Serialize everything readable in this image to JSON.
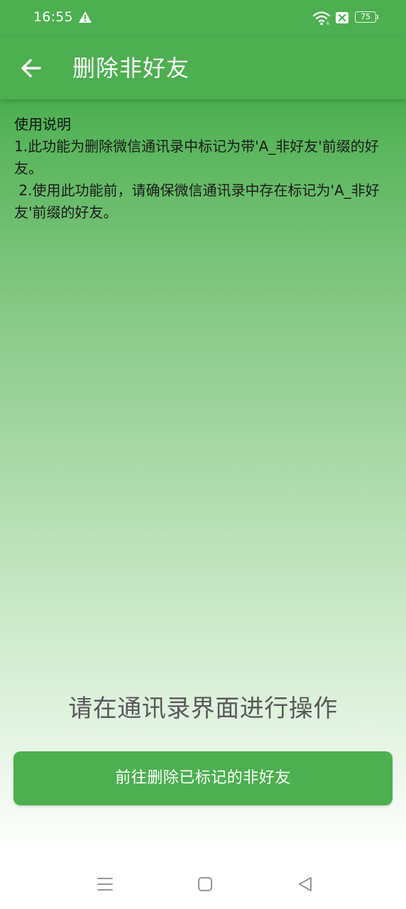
{
  "status_bar": {
    "time": "16:55",
    "battery_level": "75",
    "icons": [
      "warning-icon",
      "wifi-icon",
      "sim-card-icon",
      "battery-icon"
    ]
  },
  "app_bar": {
    "title": "删除非好友",
    "back_icon": "arrow-left-icon"
  },
  "instructions": {
    "heading": "使用说明",
    "lines": [
      "1.此功能为删除微信通讯录中标记为带'A_非好友'前缀的好友。",
      " 2.使用此功能前，请确保微信通讯录中存在标记为'A_非好友'前缀的好友。"
    ]
  },
  "prompt": "请在通讯录界面进行操作",
  "action_button": {
    "label": "前往删除已标记的非好友"
  },
  "nav_bar": {
    "icons": [
      "menu-icon",
      "home-icon",
      "back-triangle-icon"
    ]
  },
  "colors": {
    "primary_green": "#4CAF50",
    "prompt_text": "#5a5a5a",
    "body_text": "#1b1b1b"
  }
}
